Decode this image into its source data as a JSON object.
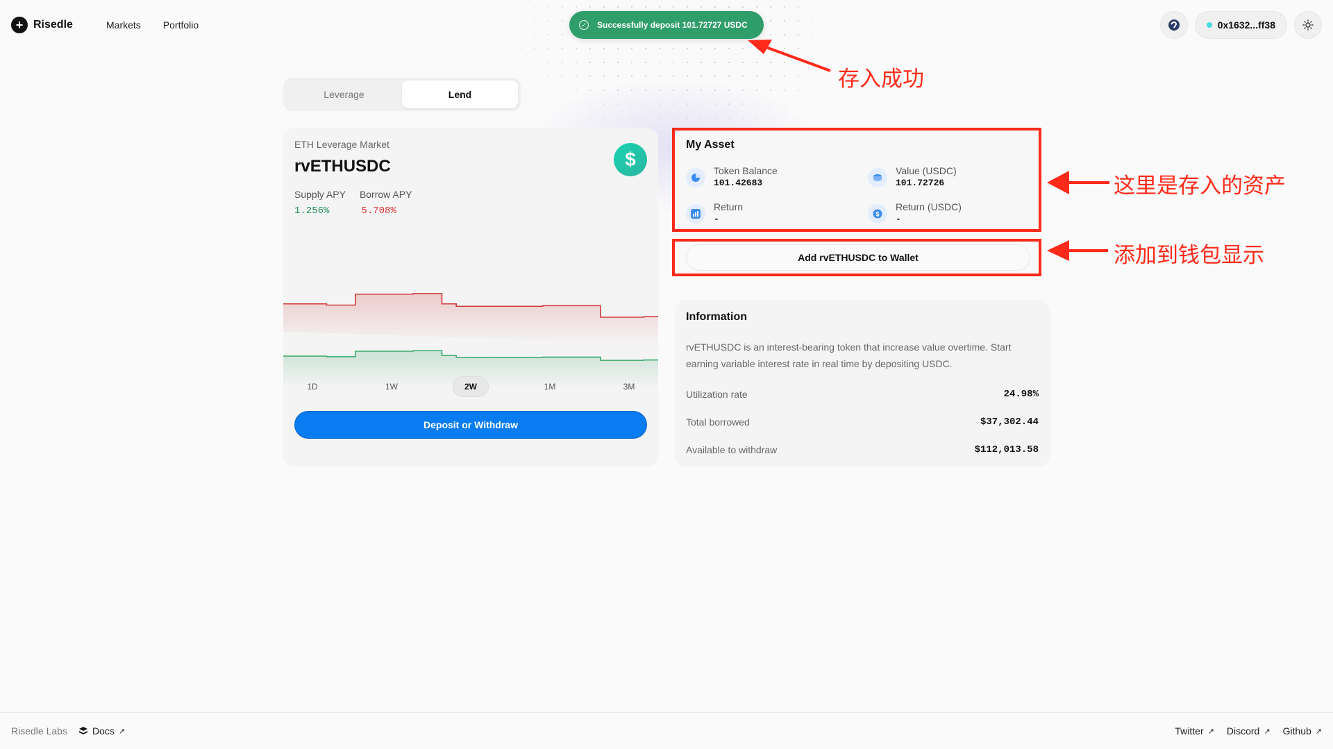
{
  "header": {
    "brand": "Risedle",
    "nav": [
      "Markets",
      "Portfolio"
    ],
    "wallet_address": "0x1632...ff38"
  },
  "toast": {
    "message": "Successfully deposit 101.72727 USDC"
  },
  "tabs": [
    {
      "label": "Leverage",
      "active": false
    },
    {
      "label": "Lend",
      "active": true
    }
  ],
  "market": {
    "subtitle": "ETH Leverage Market",
    "title": "rvETHUSDC",
    "coin_symbol": "$",
    "supply_apy_label": "Supply APY",
    "borrow_apy_label": "Borrow APY",
    "supply_apy": "1.256%",
    "borrow_apy": "5.708%",
    "ranges": [
      "1D",
      "1W",
      "2W",
      "1M",
      "3M"
    ],
    "active_range": "2W",
    "deposit_button": "Deposit or Withdraw"
  },
  "chart_data": {
    "type": "line",
    "title": "",
    "series": [
      {
        "color": "#d03a3a",
        "values": [
          5.5,
          5.5,
          5.5,
          5.4,
          5.4,
          6.3,
          6.3,
          6.3,
          6.3,
          6.35,
          6.35,
          5.5,
          5.3,
          5.3,
          5.3,
          5.3,
          5.3,
          5.3,
          5.35,
          5.35,
          5.35,
          5.35,
          4.4,
          4.4,
          4.4,
          4.45
        ]
      },
      {
        "color": "#3aa86b",
        "values": [
          1.2,
          1.2,
          1.2,
          1.15,
          1.15,
          1.6,
          1.6,
          1.6,
          1.6,
          1.65,
          1.65,
          1.25,
          1.1,
          1.1,
          1.1,
          1.1,
          1.1,
          1.1,
          1.12,
          1.12,
          1.12,
          1.12,
          0.85,
          0.85,
          0.85,
          0.88
        ]
      }
    ],
    "ylim": [
      0,
      8
    ]
  },
  "my_asset": {
    "title": "My Asset",
    "token_balance_label": "Token Balance",
    "token_balance": "101.42683",
    "value_label": "Value (USDC)",
    "value": "101.72726",
    "return_label": "Return",
    "return": "-",
    "return_usdc_label": "Return (USDC)",
    "return_usdc": "-"
  },
  "add_wallet_button": "Add rvETHUSDC to Wallet",
  "info": {
    "title": "Information",
    "description": "rvETHUSDC is an interest-bearing token that increase value overtime. Start earning variable interest rate in real time by depositing USDC.",
    "rows": [
      {
        "label": "Utilization rate",
        "value": "24.98%"
      },
      {
        "label": "Total borrowed",
        "value": "$37,302.44"
      },
      {
        "label": "Available to withdraw",
        "value": "$112,013.58"
      }
    ]
  },
  "annotations": {
    "deposit_success": "存入成功",
    "deposited_asset": "这里是存入的资产",
    "add_to_wallet": "添加到钱包显示"
  },
  "footer": {
    "labs": "Risedle Labs",
    "docs": "Docs",
    "links": [
      "Twitter",
      "Discord",
      "Github"
    ]
  },
  "colors": {
    "accent": "#0a7cf1",
    "toast": "#2f9e6a",
    "annotation": "#ff2a1a",
    "supply": "#1f8f55",
    "borrow": "#d93030"
  }
}
